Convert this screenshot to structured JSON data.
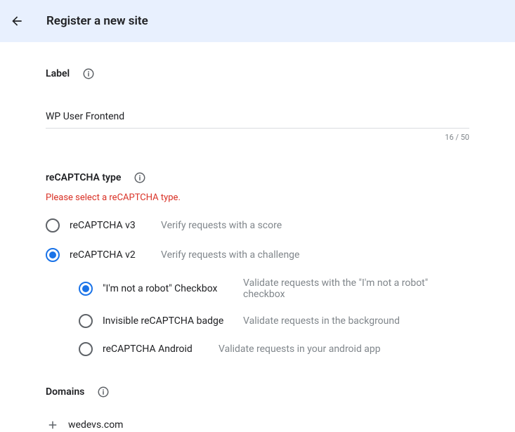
{
  "header": {
    "title": "Register a new site"
  },
  "label_section": {
    "title": "Label",
    "value": "WP User Frontend",
    "counter": "16 / 50"
  },
  "recaptcha_section": {
    "title": "reCAPTCHA type",
    "error": "Please select a reCAPTCHA type.",
    "options": [
      {
        "label": "reCAPTCHA v3",
        "desc": "Verify requests with a score",
        "selected": false
      },
      {
        "label": "reCAPTCHA v2",
        "desc": "Verify requests with a challenge",
        "selected": true
      }
    ],
    "sub_options": [
      {
        "label": "\"I'm not a robot\" Checkbox",
        "desc": "Validate requests with the \"I'm not a robot\" checkbox",
        "selected": true
      },
      {
        "label": "Invisible reCAPTCHA badge",
        "desc": "Validate requests in the background",
        "selected": false
      },
      {
        "label": "reCAPTCHA Android",
        "desc": "Validate requests in your android app",
        "selected": false
      }
    ]
  },
  "domains_section": {
    "title": "Domains",
    "items": [
      "wedevs.com"
    ]
  }
}
